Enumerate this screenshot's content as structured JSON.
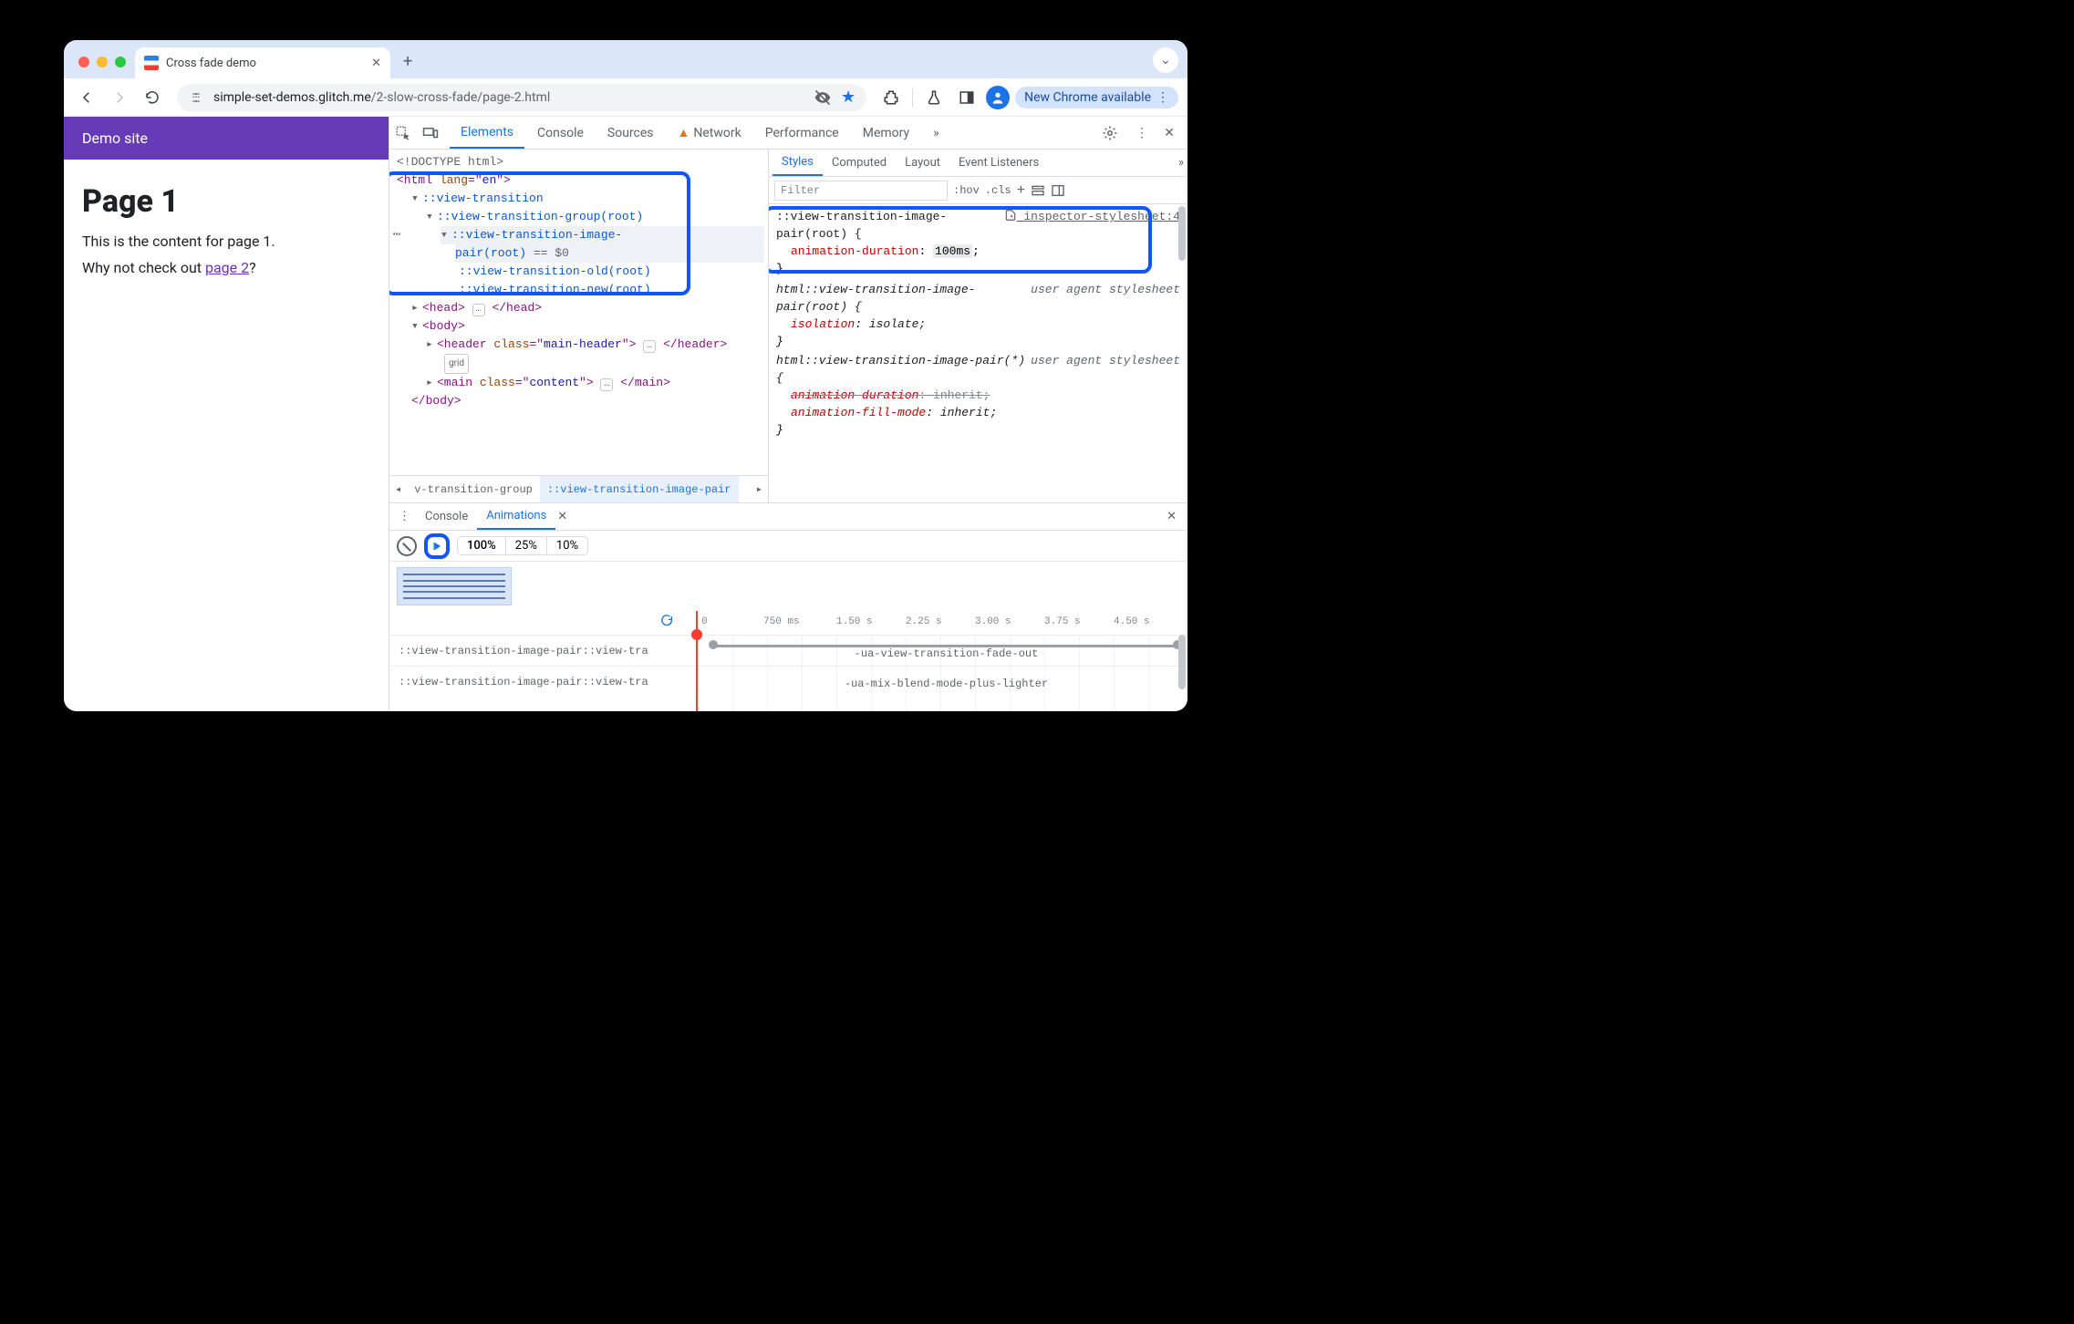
{
  "window": {
    "tab_title": "Cross fade demo",
    "url_host": "simple-set-demos.glitch.me",
    "url_path": "/2-slow-cross-fade/page-2.html",
    "update_label": "New Chrome available"
  },
  "page": {
    "site_title": "Demo site",
    "heading": "Page 1",
    "paragraph": "This is the content for page 1.",
    "cta_prefix": "Why not check out ",
    "cta_link": "page 2",
    "cta_suffix": "?"
  },
  "devtools": {
    "tabs": [
      "Elements",
      "Console",
      "Sources",
      "Network",
      "Performance",
      "Memory"
    ],
    "more": "»",
    "styles_tabs": [
      "Styles",
      "Computed",
      "Layout",
      "Event Listeners"
    ],
    "filter_placeholder": "Filter",
    "style_tools": [
      ":hov",
      ".cls",
      "+"
    ],
    "crumbs": {
      "prev": "v-transition-group",
      "current": "::view-transition-image-pair"
    },
    "drawer": {
      "tabs": [
        "Console",
        "Animations"
      ],
      "speeds": [
        "100%",
        "25%",
        "10%"
      ]
    }
  },
  "dom": {
    "doctype": "<!DOCTYPE html>",
    "html_open": "<html lang=\"en\">",
    "vt": "::view-transition",
    "vt_group": "::view-transition-group(root)",
    "vt_pair_a": "::view-transition-image-",
    "vt_pair_b": "pair(root)",
    "eq0": " == $0",
    "vt_old": "::view-transition-old(root)",
    "vt_new": "::view-transition-new(root)",
    "head": "<head>…</head>",
    "body_open": "<body>",
    "header_open": "<header class=\"main-header\">",
    "header_close": "</header>",
    "grid_badge": "grid",
    "main_open": "<main class=\"content\">",
    "main_close": "</main>",
    "body_close": "</body>",
    "ellipsis": "…"
  },
  "styles": {
    "rule1": {
      "selector": "::view-transition-image-pair(root) {",
      "source": "inspector-stylesheet:4",
      "prop": "animation-duration",
      "val": "100ms",
      "close": "}"
    },
    "rule2": {
      "selector": "html::view-transition-image-pair(root) {",
      "source": "user agent stylesheet",
      "prop": "isolation",
      "val": "isolate;",
      "close": "}"
    },
    "rule3": {
      "selector": "html::view-transition-image-pair(*) {",
      "source": "user agent stylesheet",
      "p1": "animation-duration",
      "v1": "inherit;",
      "p2": "animation-fill-mode",
      "v2": "inherit;",
      "close": "}"
    }
  },
  "animations": {
    "ticks": [
      "0",
      "750 ms",
      "1.50 s",
      "2.25 s",
      "3.00 s",
      "3.75 s",
      "4.50 s"
    ],
    "lane1_label": "::view-transition-image-pair::view-tra",
    "lane1_anim": "-ua-view-transition-fade-out",
    "lane2_label": "::view-transition-image-pair::view-tra",
    "lane2_anim": "-ua-mix-blend-mode-plus-lighter"
  }
}
